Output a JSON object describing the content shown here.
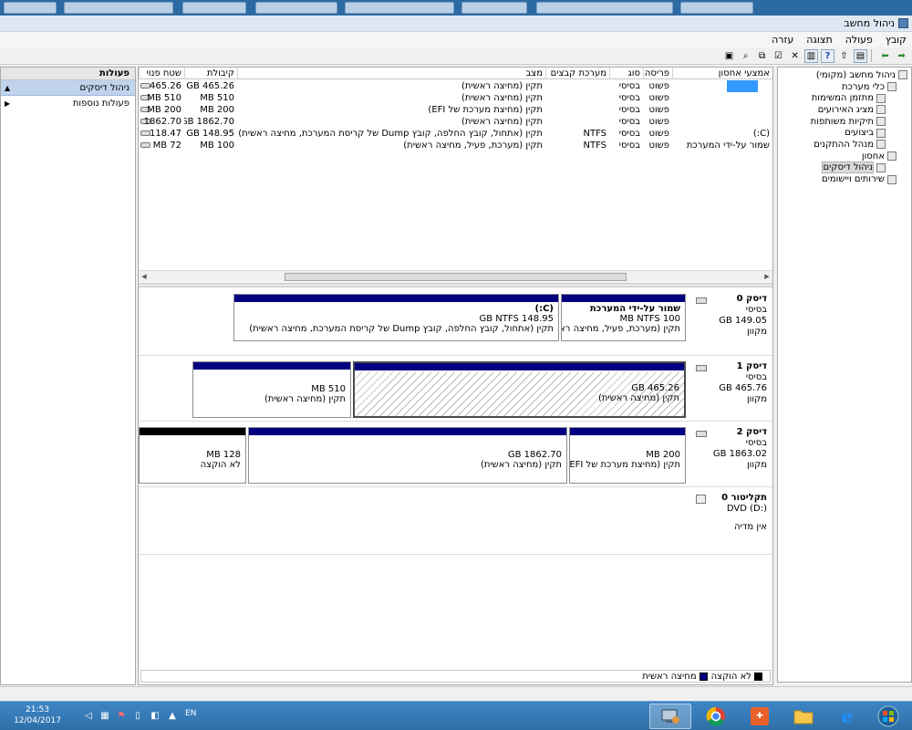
{
  "browser_tabs": [
    "",
    "",
    "",
    "",
    "",
    "",
    "",
    ""
  ],
  "window": {
    "title": "ניהול מחשב"
  },
  "menu": [
    "קובץ",
    "פעולה",
    "תצוגה",
    "עזרה"
  ],
  "tree": [
    {
      "label": "ניהול מחשב (מקומי)",
      "icon": "computer-icon",
      "level": 0
    },
    {
      "label": "כלי מערכת",
      "icon": "tools-icon",
      "level": 1
    },
    {
      "label": "מתזמן המשימות",
      "icon": "clock-icon",
      "level": 2
    },
    {
      "label": "מציג האירועים",
      "icon": "event-viewer-icon",
      "level": 2
    },
    {
      "label": "תיקיות משותפות",
      "icon": "shared-folder-icon",
      "level": 2
    },
    {
      "label": "ביצועים",
      "icon": "performance-icon",
      "level": 2
    },
    {
      "label": "מנהל ההתקנים",
      "icon": "device-manager-icon",
      "level": 2
    },
    {
      "label": "אחסון",
      "icon": "storage-icon",
      "level": 1
    },
    {
      "label": "ניהול דיסקים",
      "icon": "disk-management-icon",
      "level": 2,
      "selected": true
    },
    {
      "label": "שירותים ויישומים",
      "icon": "services-icon",
      "level": 1
    }
  ],
  "volume_columns": [
    "אמצעי אחסון",
    "פריסה",
    "סוג",
    "מערכת קבצים",
    "מצב",
    "קיבולת",
    "שטח פנוי"
  ],
  "volumes": [
    {
      "name": "",
      "layout": "פשוט",
      "type": "בסיסי",
      "fs": "",
      "status": "תקין (מחיצה ראשית)",
      "capacity": "465.26 GB",
      "free": "465.26"
    },
    {
      "name": "",
      "layout": "פשוט",
      "type": "בסיסי",
      "fs": "",
      "status": "תקין (מחיצה ראשית)",
      "capacity": "510 MB",
      "free": "510 MB"
    },
    {
      "name": "",
      "layout": "פשוט",
      "type": "בסיסי",
      "fs": "",
      "status": "תקין (מחיצת מערכת של EFI)",
      "capacity": "200 MB",
      "free": "200 MB"
    },
    {
      "name": "",
      "layout": "פשוט",
      "type": "בסיסי",
      "fs": "",
      "status": "תקין (מחיצה ראשית)",
      "capacity": "1862.70 GB",
      "free": "1862.70"
    },
    {
      "name": "(C:)",
      "layout": "פשוט",
      "type": "בסיסי",
      "fs": "NTFS",
      "status": "תקין (אתחול, קובץ החלפה, קובץ Dump של קריסת המערכת, מחיצה ראשית)",
      "capacity": "148.95 GB",
      "free": "118.47"
    },
    {
      "name": "שמור על-ידי המערכת",
      "layout": "פשוט",
      "type": "בסיסי",
      "fs": "NTFS",
      "status": "תקין (מערכת, פעיל, מחיצה ראשית)",
      "capacity": "100 MB",
      "free": "72 MB"
    }
  ],
  "disks": [
    {
      "name": "דיסק 0",
      "type": "בסיסי",
      "size": "149.05 GB",
      "state": "מקוון",
      "partitions": [
        {
          "title": "שמור על-ידי המערכת",
          "line1": "100 MB NTFS",
          "line2": "תקין (מערכת, פעיל, מחיצה ראשית)"
        },
        {
          "title": "(C:)",
          "line1": "148.95 GB NTFS",
          "line2": "תקין (אתחול, קובץ החלפה, קובץ Dump של קריסת המערכת, מחיצה ראשית)"
        }
      ]
    },
    {
      "name": "דיסק 1",
      "type": "בסיסי",
      "size": "465.76 GB",
      "state": "מקוון",
      "partitions": [
        {
          "line1": "465.26 GB",
          "line2": "תקין (מחיצה ראשית)"
        },
        {
          "line1": "510 MB",
          "line2": "תקין (מחיצה ראשית)"
        }
      ]
    },
    {
      "name": "דיסק 2",
      "type": "בסיסי",
      "size": "1863.02 GB",
      "state": "מקוון",
      "partitions": [
        {
          "line1": "200 MB",
          "line2": "תקין (מחיצת מערכת של EFI)"
        },
        {
          "line1": "1862.70 GB",
          "line2": "תקין (מחיצה ראשית)"
        },
        {
          "line1": "128 MB",
          "line2": "לא הוקצה"
        }
      ]
    }
  ],
  "dvd": {
    "name": "תקליטור 0",
    "type": "DVD (D:)",
    "media": "אין מדיה"
  },
  "legend": [
    {
      "label": "לא הוקצה",
      "color": "#000000"
    },
    {
      "label": "מחיצה ראשית",
      "color": "#000080"
    }
  ],
  "actions": {
    "header": "פעולות",
    "items": [
      "ניהול דיסקים",
      "פעולות נוספות"
    ]
  },
  "taskbar": {
    "time": "21:53",
    "date": "12/04/2017",
    "lang": "EN"
  }
}
